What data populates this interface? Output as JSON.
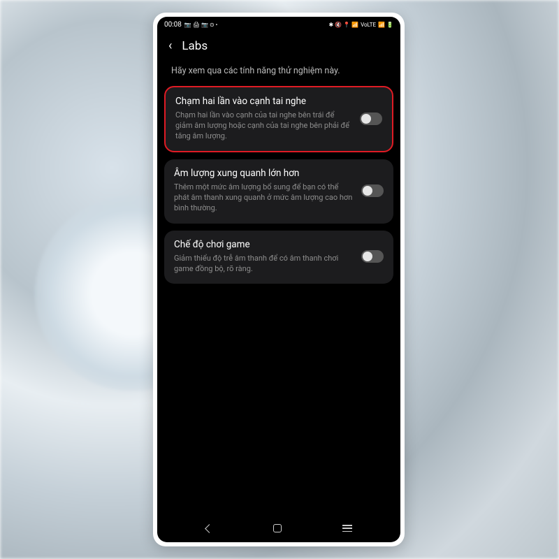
{
  "statusbar": {
    "time": "00:08",
    "left_icons": [
      "📷",
      "🖨",
      "📷",
      "⊙",
      "•"
    ],
    "right_text": "VoLTE",
    "right_icons": [
      "✱",
      "🔇",
      "📍",
      "≈",
      "📶",
      "🔋"
    ]
  },
  "header": {
    "back": "‹",
    "title": "Labs"
  },
  "subtitle": "Hãy xem qua các tính năng thử nghiệm này.",
  "cards": [
    {
      "title": "Chạm hai lần vào cạnh tai nghe",
      "desc": "Chạm hai lần vào cạnh của tai nghe bên trái để giảm âm lượng hoặc cạnh của tai nghe bên phải để tăng âm lượng.",
      "highlighted": true,
      "toggle_on": false
    },
    {
      "title": "Âm lượng xung quanh lớn hơn",
      "desc": "Thêm một mức âm lượng bổ sung để bạn có thể phát âm thanh xung quanh ở mức âm lượng cao hơn bình thường.",
      "highlighted": false,
      "toggle_on": false
    },
    {
      "title": "Chế độ chơi game",
      "desc": "Giảm thiểu độ trễ âm thanh để có âm thanh chơi game đồng bộ, rõ ràng.",
      "highlighted": false,
      "toggle_on": false
    }
  ]
}
